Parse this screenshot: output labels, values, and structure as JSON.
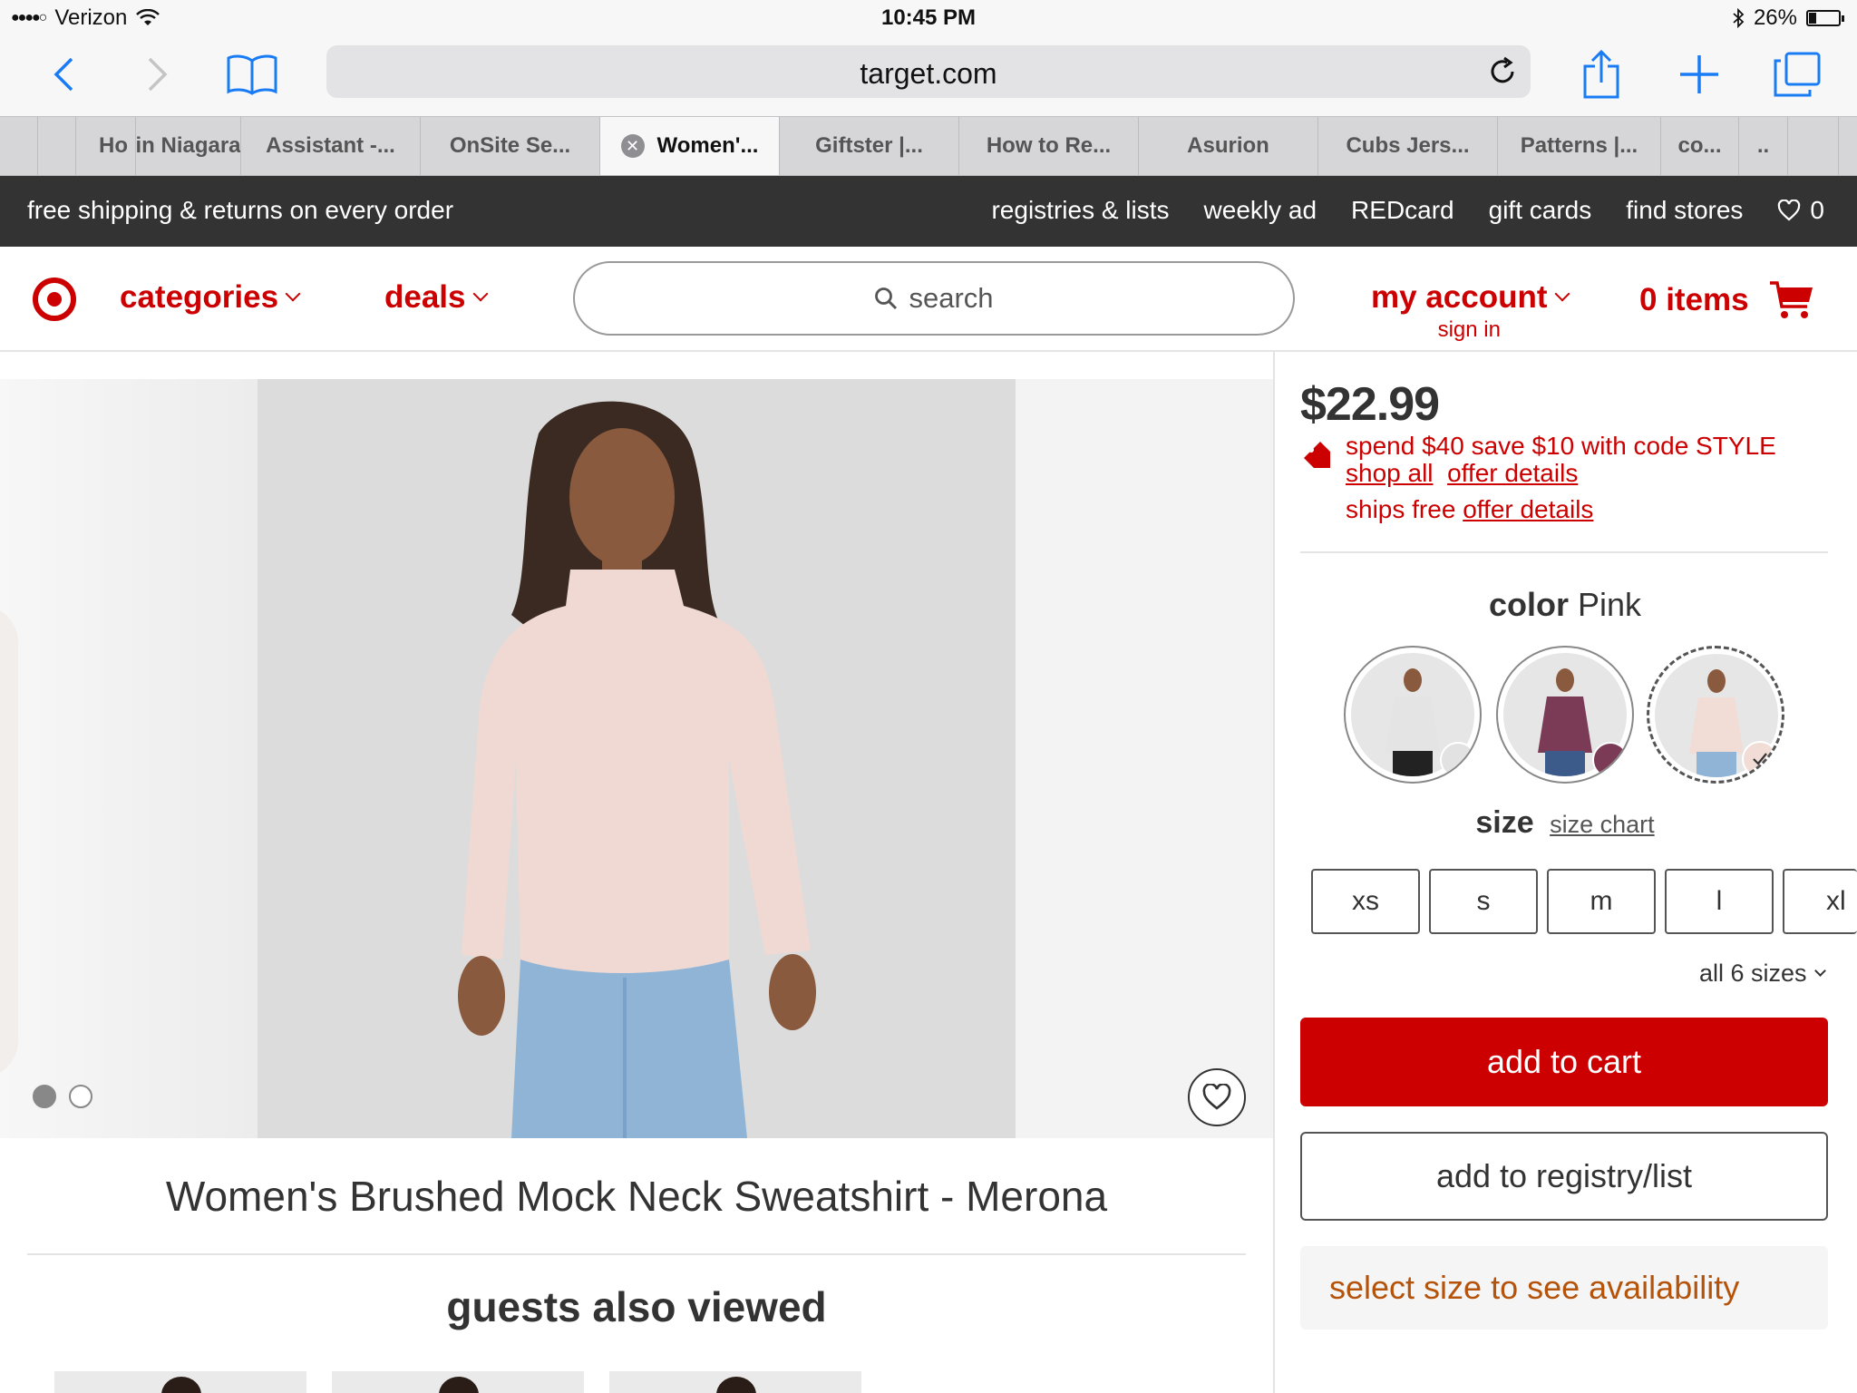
{
  "status_bar": {
    "signal": "●●●●○",
    "carrier": "Verizon",
    "time": "10:45 PM",
    "battery": "26%",
    "battery_level": 0.26
  },
  "browser": {
    "url": "target.com",
    "tabs": [
      {
        "label": "Ho"
      },
      {
        "label": "in Niagara"
      },
      {
        "label": "Assistant -..."
      },
      {
        "label": "OnSite Se..."
      },
      {
        "label": "Women'...",
        "active": true
      },
      {
        "label": "Giftster |..."
      },
      {
        "label": "How to Re..."
      },
      {
        "label": "Asurion"
      },
      {
        "label": "Cubs Jers..."
      },
      {
        "label": "Patterns |..."
      },
      {
        "label": "co..."
      },
      {
        "label": ".."
      }
    ]
  },
  "promo_bar": {
    "message": "free shipping & returns on every order",
    "links": [
      "registries & lists",
      "weekly ad",
      "REDcard",
      "gift cards",
      "find stores"
    ],
    "favorites_count": "0"
  },
  "header": {
    "categories": "categories",
    "deals": "deals",
    "search_placeholder": "search",
    "my_account": "my account",
    "sign_in": "sign in",
    "cart": "0 items"
  },
  "product": {
    "title": "Women's Brushed Mock Neck Sweatshirt - Merona",
    "price": "$22.99",
    "promo": "spend $40 save $10 with code STYLE",
    "shop_all": "shop all",
    "offer_details": "offer details",
    "ships_free": "ships free",
    "ships_offer_details": "offer details",
    "color_label": "color",
    "color_value": "Pink",
    "swatches": [
      {
        "name": "light gray",
        "color": "#e2e2e2"
      },
      {
        "name": "burgundy",
        "color": "#7b3a55"
      },
      {
        "name": "pink",
        "color": "#f1dcd6",
        "selected": true
      }
    ],
    "size_label": "size",
    "size_chart": "size chart",
    "sizes": [
      "xs",
      "s",
      "m",
      "l",
      "xl"
    ],
    "all_sizes": "all 6 sizes",
    "add_to_cart": "add to cart",
    "add_to_registry": "add to registry/list",
    "availability": "select size to see availability",
    "carousel_dots": 2,
    "carousel_index": 0
  },
  "recommendations": {
    "heading": "guests also viewed"
  },
  "colors": {
    "brand_red": "#cc0000",
    "promo_bar": "#333333",
    "availability_text": "#b45309",
    "safari_blue": "#1a7cf5"
  }
}
